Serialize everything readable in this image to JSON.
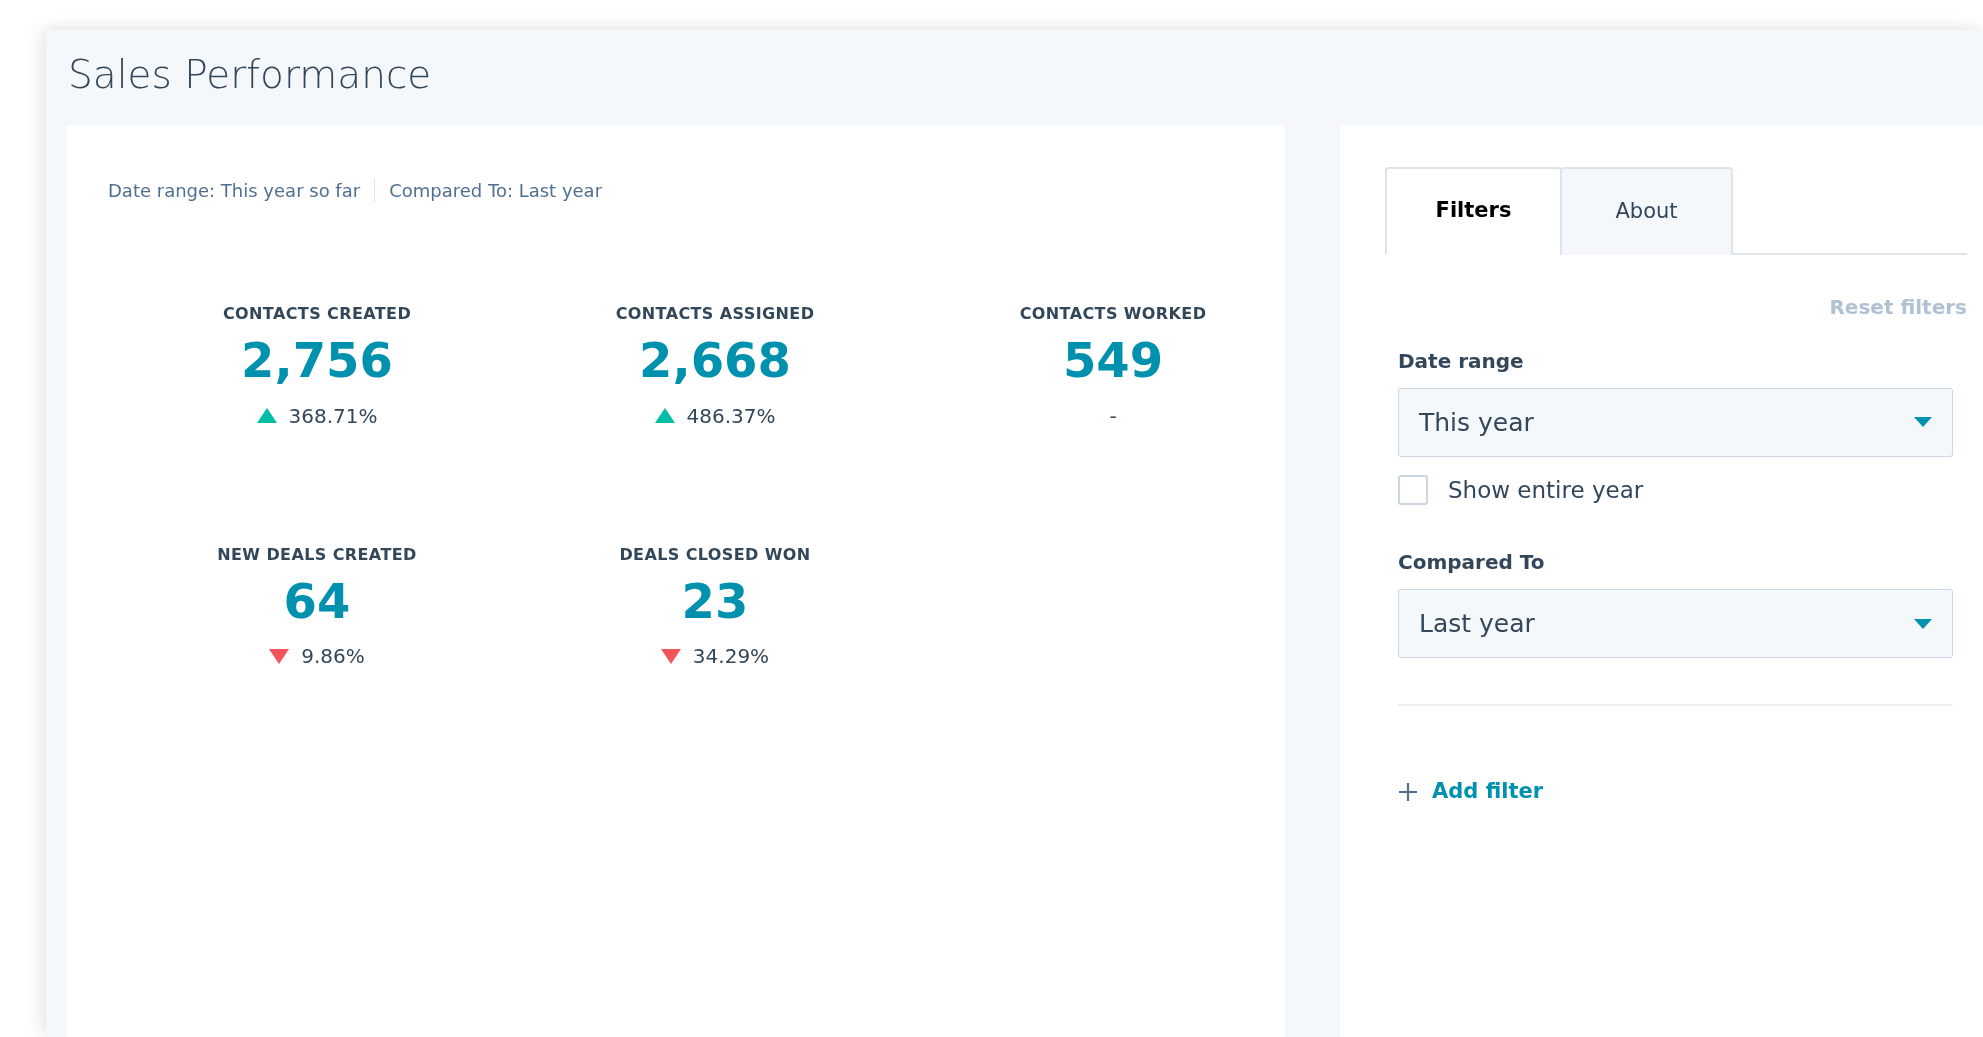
{
  "page": {
    "title": "Sales Performance"
  },
  "summary": {
    "date_range": "Date range: This year so far",
    "compared_to": "Compared To: Last year"
  },
  "metrics": [
    {
      "label": "CONTACTS CREATED",
      "value": "2,756",
      "kind": "up",
      "change": "368.71%"
    },
    {
      "label": "CONTACTS ASSIGNED",
      "value": "2,668",
      "kind": "up",
      "change": "486.37%"
    },
    {
      "label": "CONTACTS WORKED",
      "value": "549",
      "kind": "flat",
      "change": "-"
    },
    {
      "label": "NEW DEALS CREATED",
      "value": "64",
      "kind": "down",
      "change": "9.86%"
    },
    {
      "label": "DEALS CLOSED WON",
      "value": "23",
      "kind": "down",
      "change": "34.29%"
    }
  ],
  "tabs": [
    {
      "label": "Filters",
      "selected": true
    },
    {
      "label": "About",
      "selected": false
    }
  ],
  "filters": {
    "reset": "Reset filters",
    "date_range": {
      "label": "Date range",
      "value": "This year"
    },
    "show_entire_year": {
      "label": "Show entire year",
      "checked": false
    },
    "compared_to": {
      "label": "Compared To",
      "value": "Last year"
    },
    "add_filter": "Add filter"
  }
}
